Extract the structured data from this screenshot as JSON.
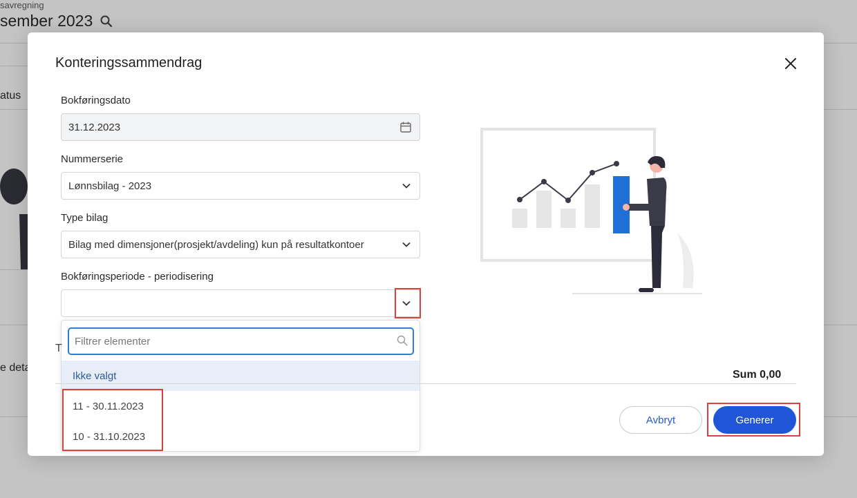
{
  "background": {
    "subtitle": "savregning",
    "title": "sember 2023",
    "status_text": "atus",
    "detail_text": "e deta"
  },
  "modal": {
    "title": "Konteringssammendrag",
    "close_icon": "close-icon"
  },
  "form": {
    "booking_date": {
      "label": "Bokføringsdato",
      "value": "31.12.2023"
    },
    "number_series": {
      "label": "Nummerserie",
      "value": "Lønnsbilag - 2023"
    },
    "voucher_type": {
      "label": "Type bilag",
      "value": "Bilag med dimensjoner(prosjekt/avdeling) kun på resultatkontoer"
    },
    "period": {
      "label": "Bokføringsperiode - periodisering",
      "value": ""
    }
  },
  "dropdown": {
    "filter_placeholder": "Filtrer elementer",
    "options": [
      {
        "label": "Ikke valgt",
        "selected": true
      },
      {
        "label": "11 - 30.11.2023",
        "selected": false
      },
      {
        "label": "10 - 31.10.2023",
        "selected": false
      }
    ]
  },
  "summary": {
    "t_label": "T",
    "sum_text": "Sum 0,00"
  },
  "buttons": {
    "cancel": "Avbryt",
    "generate": "Generer"
  },
  "colors": {
    "accent": "#1f55d6",
    "highlight": "#d9413a",
    "selected_bg": "#e7eef7"
  }
}
